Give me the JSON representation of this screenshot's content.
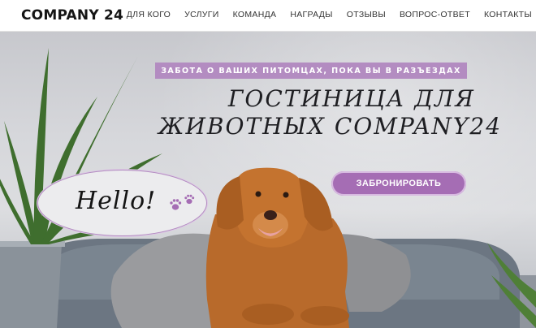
{
  "header": {
    "logo": "COMPANY 24",
    "nav": [
      "ДЛЯ КОГО",
      "УСЛУГИ",
      "КОМАНДА",
      "НАГРАДЫ",
      "ОТЗЫВЫ",
      "ВОПРОС-ОТВЕТ",
      "КОНТАКТЫ"
    ]
  },
  "hero": {
    "tagline": "ЗАБОТА О ВАШИХ ПИТОМЦАХ, ПОКА ВЫ В РАЗЪЕЗДАХ",
    "title_line1": "ГОСТИНИЦА ДЛЯ",
    "title_line2": "ЖИВОТНЫХ COMPANY24",
    "book_button": "ЗАБРОНИРОВАТЬ",
    "hello": "Hello!"
  },
  "icons": [
    "paw-icon",
    "dog-illustration",
    "plant-illustration"
  ],
  "colors": {
    "accent": "#b38cc1",
    "button": "#a56db4",
    "text": "#151515"
  }
}
